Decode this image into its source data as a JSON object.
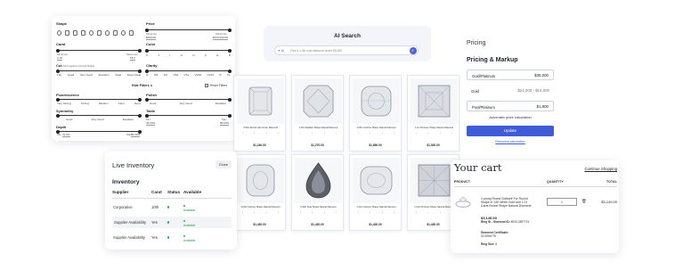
{
  "filters": {
    "shape_label": "Shape",
    "price": {
      "label": "Price",
      "min_label": "Minimum",
      "min": "$200.00",
      "max_label": "Maximum",
      "max": "$100,000.00"
    },
    "carat": {
      "label": "Carat",
      "min_label": "Minimum",
      "min": "0.18",
      "max_label": "Maximum",
      "max": "15.0"
    },
    "color": {
      "label": "Color",
      "options": [
        "K",
        "J",
        "I",
        "H",
        "G",
        "F",
        "E",
        "D"
      ]
    },
    "cut": {
      "label": "Cut",
      "note": "(Only applies to Round Shape)",
      "options": [
        "Fair",
        "Good",
        "Very Good",
        "Excellent",
        "Ideal",
        "Super Ideal"
      ]
    },
    "clarity": {
      "label": "Clarity",
      "options": [
        "I1",
        "SI2",
        "SI1",
        "VS2",
        "VS1",
        "VVS2",
        "VVS1",
        "IF",
        "FL"
      ]
    },
    "hide_filters": "Hide Filters ∧",
    "reset": "Reset Filters",
    "fluorescence": {
      "label": "Fluorescence",
      "options": [
        "Very Strong",
        "Strong",
        "Medium",
        "Faint",
        "None"
      ]
    },
    "polish": {
      "label": "Polish",
      "options": [
        "Good",
        "Very Good",
        "Excellent"
      ]
    },
    "symmetry": {
      "label": "Symmetry",
      "options": [
        "Good",
        "Very Good",
        "Excellent"
      ]
    },
    "table": {
      "label": "Table",
      "min_label": "Min",
      "min": "45.00%",
      "max_label": "Max",
      "max": "85.00%"
    },
    "depth": {
      "label": "Depth",
      "min_label": "Min",
      "min": "41.0%",
      "max_label": "Max",
      "max": "89.00%"
    }
  },
  "ai_search": {
    "title": "AI Search",
    "badge": "AI",
    "placeholder": "Find a 1.5ct oval diamond under $6,000"
  },
  "diamonds": [
    {
      "name": "0.50ct Round Lab Grown Diamond",
      "price": "$1,240.00",
      "shape": "emerald"
    },
    {
      "name": "1.01ct Radiant Shape Natural Diamond",
      "price": "$1,270.00",
      "shape": "radiant"
    },
    {
      "name": "1.05ct Cushion Shape Natural Diamond",
      "price": "$1,890.00",
      "shape": "cushion"
    },
    {
      "name": "1.1ct Princess Shape Natural Diamond",
      "price": "$1,920.00",
      "shape": "princess"
    },
    {
      "name": "1.00ct Cushion Shape Natural Diamond",
      "price": "$1,420.00",
      "shape": "cushion2"
    },
    {
      "name": "0.90ct Pear Shape Natural Diamond",
      "price": "$1,420.00",
      "shape": "pear"
    },
    {
      "name": "1.01ct Cushion Shape Natural Diamond",
      "price": "$1,420.00",
      "shape": "cushion3"
    },
    {
      "name": "1.01ct Princess Shape Natural Diamond",
      "price": "$1,420.00",
      "shape": "princess2"
    }
  ],
  "pricing": {
    "header": "Pricing",
    "title": "Pricing & Markup",
    "rows": [
      {
        "label": "Gold/Platinum",
        "value": "$35,000"
      },
      {
        "label": "Gold",
        "value": "$24,000 - $15,000"
      },
      {
        "label": "Pool/Platinum",
        "value": "$1,900"
      }
    ],
    "auto": "Automatic price calculation",
    "update": "Update",
    "link": "Resource calculation"
  },
  "inventory": {
    "header": "Live Inventory",
    "close": "Close",
    "title": "Inventory",
    "columns": [
      "Supplier",
      "Carat",
      "Status",
      "Available"
    ],
    "rows": [
      {
        "supplier": "Corporative",
        "carat": "10th",
        "available": "Available"
      },
      {
        "supplier": "Supplier Availability",
        "carat": "Yes",
        "available": "Available"
      },
      {
        "supplier": "Supplier Availability",
        "carat": "Yes",
        "available": "Available"
      }
    ]
  },
  "cart": {
    "title": "Your cart",
    "continue": "Continue Shopping",
    "columns": [
      "PRODUCT",
      "QUANTITY",
      "TOTAL"
    ],
    "item": {
      "description": "4 prong Round Solitaire For Round Shape in 14K White Gold and 1.01 Carat Round Shape Natural Diamond",
      "price": "$3,149.00",
      "ring_id_label": "Ring ID - Diamond ID:",
      "ring_id": "8000-2897724",
      "cert_label": "Diamond Certificate:",
      "cert": "SG1966776",
      "size_label": "Ring Size:",
      "size": "6",
      "quantity": "1",
      "total": "$3,149.00"
    }
  },
  "colors": {
    "accent": "#3f5bd6",
    "available": "#2bb24c"
  }
}
